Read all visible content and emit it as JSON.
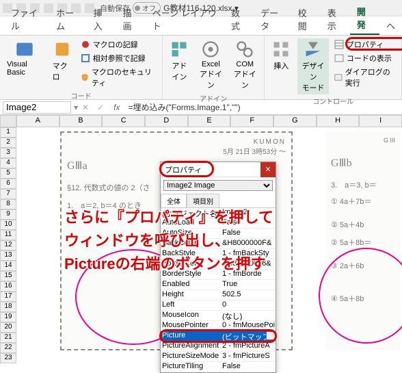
{
  "titlebar": {
    "autosave_label": "自動保存",
    "autosave_state": "オフ",
    "filename": "G教材116-120.xlsx ▾"
  },
  "tabs": [
    "ファイル",
    "ホーム",
    "挿入",
    "描画",
    "ページ レイアウト",
    "数式",
    "データ",
    "校閲",
    "表示",
    "開発",
    "ヘ"
  ],
  "active_tab": 9,
  "ribbon": {
    "code": {
      "vb": "Visual Basic",
      "macro": "マクロ",
      "record": "マクロの記録",
      "relref": "相対参照で記録",
      "security": "マクロのセキュリティ",
      "label": "コード"
    },
    "addins": {
      "add": "アド\nイン",
      "excel": "Excel\nアドイン",
      "com": "COM\nアドイン",
      "label": "アドイン"
    },
    "controls": {
      "insert": "挿入",
      "design": "デザイン\nモード",
      "prop": "プロパティ",
      "code": "コードの表示",
      "dialog": "ダイアログの実行",
      "label": "コントロール"
    }
  },
  "namebox": "Image2",
  "formula": "=埋め込み(\"Forms.Image.1\",\"\")",
  "columns": [
    "A",
    "B",
    "C",
    "D",
    "E",
    "F",
    "G",
    "H",
    "I"
  ],
  "rows": [
    "1",
    "2",
    "3",
    "4",
    "5",
    "6",
    "7",
    "8",
    "9",
    "10",
    "11",
    "12",
    "13",
    "14",
    "15",
    "16",
    "17",
    "18",
    "19",
    "20",
    "21",
    "22",
    "23"
  ],
  "worksheet": {
    "kumon": "KUMON",
    "date": "5月 21日  3時53分 ～",
    "titleA": "GⅢa",
    "titleB": "GⅢb",
    "section12": "§12. 代数式の値の 2（さ",
    "line1": "1.　a＝2,  b＝4 のとき",
    "line3": "3.　a＝3,  b＝",
    "item1": "① 4a＋7b＝",
    "item2": "② 5a＋4b",
    "item3": "② 5a＋8b＝",
    "item4": "③ 2a＋6b",
    "item5": "④ 5a＋8b",
    "gcode": "G III"
  },
  "properties": {
    "title": "プロパティ",
    "object_selector": "Image2 Image",
    "tab_all": "全体",
    "tab_cat": "項目別",
    "rows": [
      {
        "name": "(オブジェクト名)",
        "val": "Image2"
      },
      {
        "name": "AutoLoad",
        "val": "False"
      },
      {
        "name": "AutoSize",
        "val": "False"
      },
      {
        "name": "BackColor",
        "val": "&H8000000F&"
      },
      {
        "name": "BackStyle",
        "val": "1 - fmBackSty"
      },
      {
        "name": "BorderColor",
        "val": "&H80000006&"
      },
      {
        "name": "BorderStyle",
        "val": "1 - fmBorde"
      },
      {
        "name": "Enabled",
        "val": "True"
      },
      {
        "name": "Height",
        "val": "502.5"
      },
      {
        "name": "Left",
        "val": "0"
      },
      {
        "name": "MouseIcon",
        "val": "(なし)"
      },
      {
        "name": "MousePointer",
        "val": "0 - fmMousePoi"
      },
      {
        "name": "Picture",
        "val": "(ビットマップ)",
        "selected": true,
        "btn": "..."
      },
      {
        "name": "PictureAlignment",
        "val": "2 - fmPictureA"
      },
      {
        "name": "PictureSizeMode",
        "val": "3 - fmPictureS"
      },
      {
        "name": "PictureTiling",
        "val": "False"
      }
    ]
  },
  "annotation": {
    "l1": "さらに『プロパティ』を押して",
    "l2": "ウィンドウを呼び出し、",
    "l3": "Pictureの右端のボタンを押す"
  }
}
